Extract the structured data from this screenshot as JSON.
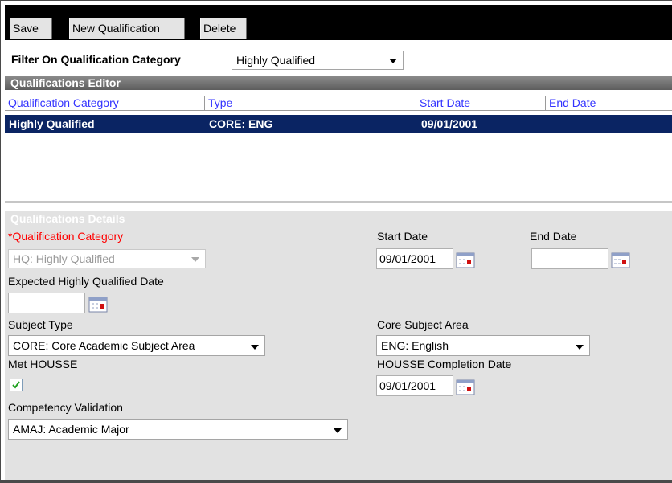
{
  "toolbar": {
    "save_label": "Save",
    "new_label": "New Qualification",
    "delete_label": "Delete"
  },
  "filter": {
    "label": "Filter On Qualification Category",
    "selected": "Highly Qualified"
  },
  "editor": {
    "title": "Qualifications Editor",
    "columns": [
      "Qualification Category",
      "Type",
      "Start Date",
      "End Date"
    ],
    "rows": [
      {
        "category": "Highly Qualified",
        "type": "CORE: ENG",
        "start": "09/01/2001",
        "end": ""
      }
    ]
  },
  "details": {
    "title": "Qualifications Details",
    "qualification_category": {
      "label": "*Qualification Category",
      "value": "HQ: Highly Qualified"
    },
    "start_date": {
      "label": "Start Date",
      "value": "09/01/2001"
    },
    "end_date": {
      "label": "End Date",
      "value": ""
    },
    "expected_hq_date": {
      "label": "Expected Highly Qualified Date",
      "value": ""
    },
    "subject_type": {
      "label": "Subject Type",
      "value": "CORE: Core Academic Subject Area"
    },
    "core_subject_area": {
      "label": "Core Subject Area",
      "value": "ENG: English"
    },
    "met_housse": {
      "label": "Met HOUSSE",
      "checked": true
    },
    "housse_completion_date": {
      "label": "HOUSSE Completion Date",
      "value": "09/01/2001"
    },
    "competency_validation": {
      "label": "Competency Validation",
      "value": "AMAJ: Academic Major"
    }
  },
  "colors": {
    "selected_row": "#0a2463",
    "header_text": "#3333ff",
    "required": "#ff0000",
    "details_bg": "#e2e2e2"
  }
}
